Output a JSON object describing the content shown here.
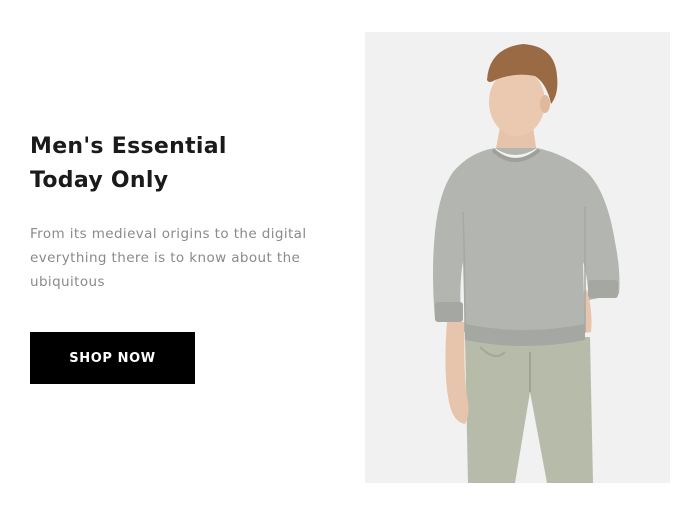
{
  "promo": {
    "title_line1": "Men's Essential",
    "title_line2": "Today Only",
    "description": "From its medieval origins to the digital everything there is to know about the ubiquitous",
    "button_label": "SHOP NOW"
  },
  "image": {
    "subject": "man-in-grey-sweatshirt-photo"
  },
  "colors": {
    "button_bg": "#000000",
    "button_text": "#ffffff",
    "title": "#1a1a1a",
    "description": "#8a8a8a",
    "image_bg": "#f1f1f1"
  }
}
